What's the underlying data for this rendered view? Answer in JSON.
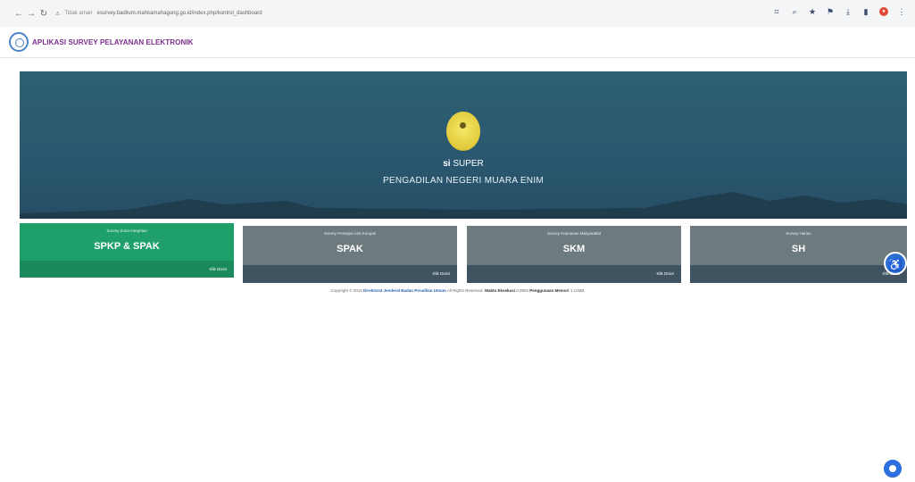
{
  "browser": {
    "back_icon": "arrow-left-icon",
    "forward_icon": "arrow-right-icon",
    "reload_icon": "reload-icon",
    "security_label": "Tidak aman",
    "url": "esurvey.badilum.mahkamahagung.go.id/index.php/kontrol_dashboard"
  },
  "header": {
    "title": "APLIKASI SURVEY PELAYANAN ELEKTRONIK"
  },
  "hero": {
    "brand_prefix": "si",
    "brand_name": "SUPER",
    "subtitle": "PENGADILAN NEGERI MUARA ENIM"
  },
  "cards": [
    {
      "subtitle": "Survey Zona Integritas",
      "name": "SPKP & SPAK",
      "action": "Klik Disini",
      "color": "#1fa06b"
    },
    {
      "subtitle": "Survey Persepsi Anti Korupsi",
      "name": "SPAK",
      "action": "Klik Disini",
      "color": "#6d7b7f"
    },
    {
      "subtitle": "Survey Kepuasan Masyarakat",
      "name": "SKM",
      "action": "Klik Disini",
      "color": "#6d7b7f"
    },
    {
      "subtitle": "Survey Harian",
      "name": "SH",
      "action": "Klik Disini",
      "color": "#6d7b7f"
    }
  ],
  "footer": {
    "prefix": "Copyright © 2019",
    "org": "Direktorat Jenderal Badan Peradilan Umum",
    "rights": "All Rights Reserved.",
    "dev_label": "Waktu Eksekusi",
    "dev_value": "0.0802",
    "mem_label": "Penggunaan Memori",
    "mem_value": "1.12MB"
  },
  "accessibility_icon": "accessibility-icon",
  "chat_icon": "chat-icon"
}
